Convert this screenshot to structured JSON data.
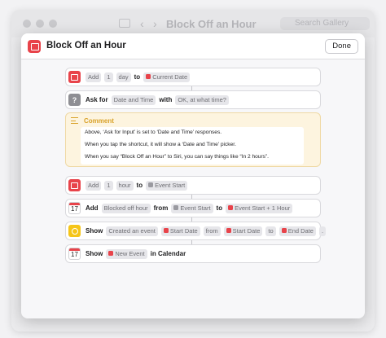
{
  "background_window": {
    "title": "Block Off an Hour",
    "search_placeholder": "Search Gallery"
  },
  "sheet": {
    "title": "Block Off an Hour",
    "done_label": "Done"
  },
  "colors": {
    "accent_red": "#e8434a",
    "comment_yellow": "#d9a22a",
    "search_yellow": "#f5c518"
  },
  "actions": [
    {
      "icon": "calendar-icon",
      "parts": [
        "Add",
        "1",
        "day",
        "to",
        "Current Date"
      ]
    },
    {
      "icon": "question-icon",
      "icon_glyph": "?",
      "parts": [
        "Ask for",
        "Date and Time",
        "with",
        "OK, at what time?"
      ]
    },
    {
      "icon": "comment-icon",
      "label": "Comment",
      "lines": [
        "Above, ‘Ask for Input’ is set to ‘Date and Time’ responses.",
        "When you tap the shortcut, it will show a ‘Date and Time’ picker.",
        "When you say “Block Off an Hour” to Siri, you can say things like “In 2 hours”."
      ]
    },
    {
      "icon": "calendar-icon",
      "parts": [
        "Add",
        "1",
        "hour",
        "to",
        "Event Start"
      ]
    },
    {
      "icon": "calendar-app-icon",
      "cal_day": "17",
      "parts": [
        "Add",
        "Blocked off hour",
        "from",
        "Event Start",
        "to",
        "Event Start + 1 Hour"
      ]
    },
    {
      "icon": "search-result-icon",
      "parts": [
        "Show",
        "Created an event",
        "Start Date",
        "from",
        "Start Date",
        "to",
        "End Date",
        "."
      ]
    },
    {
      "icon": "calendar-app-icon",
      "cal_day": "17",
      "parts": [
        "Show",
        "New Event",
        "in Calendar"
      ]
    }
  ]
}
